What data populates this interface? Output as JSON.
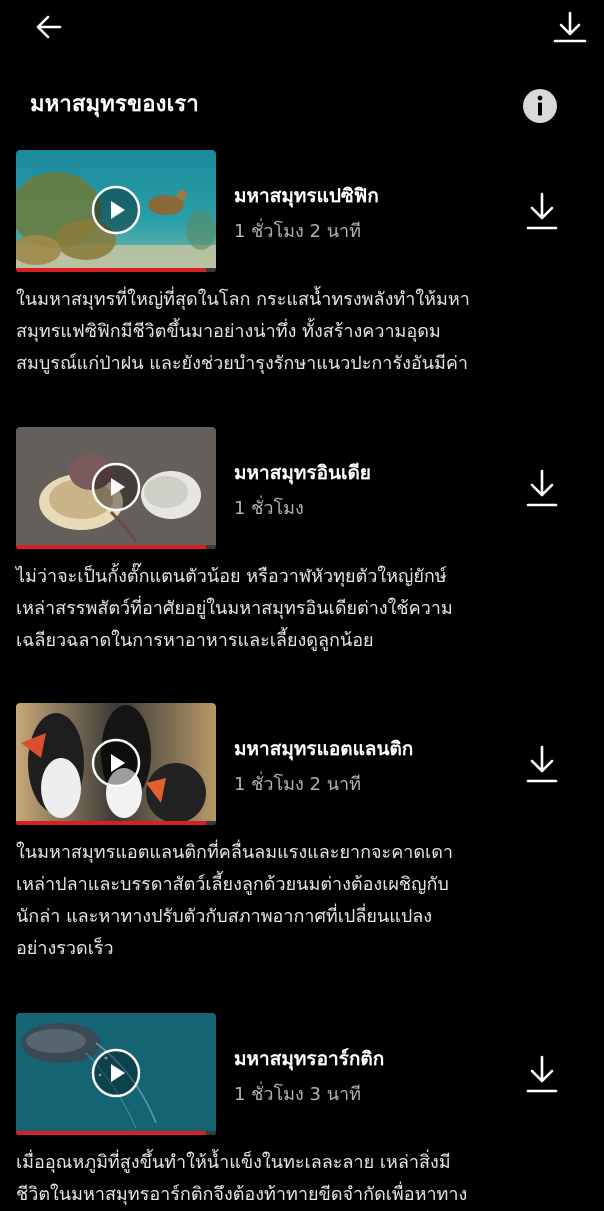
{
  "header": {
    "title": "มหาสมุทรของเรา"
  },
  "icons": {
    "back": "arrow-left-icon",
    "download": "download-icon",
    "info": "info-icon",
    "play": "play-icon"
  },
  "colors": {
    "background": "#000000",
    "progress": "#d81f26",
    "muted_text": "#b3b3b3"
  },
  "episodes": [
    {
      "title": "มหาสมุทรแปซิฟิก",
      "duration": "1 ชั่วโมง 2 นาที",
      "progress": 0.95,
      "description_lines": [
        "ในมหาสมุทรที่ใหญ่ที่สุดในโลก กระแสน้ำทรงพลังทำให้มหา",
        "สมุทรแฟซิฟิกมีชีวิตขึ้นมาอย่างน่าทึ่ง ทั้งสร้างความอุดม",
        "สมบูรณ์แก่ป่าฝน และยังช่วยบำรุงรักษาแนวปะการังอันมีค่า"
      ]
    },
    {
      "title": "มหาสมุทรอินเดีย",
      "duration": "1 ชั่วโมง",
      "progress": 0.95,
      "description_lines": [
        "ไม่ว่าจะเป็นกั้งตั๊กแตนตัวน้อย หรือวาฬหัวทุยตัวใหญ่ยักษ์",
        "เหล่าสรรพสัตว์ที่อาศัยอยู่ในมหาสมุทรอินเดียต่างใช้ความ",
        "เฉลียวฉลาดในการหาอาหารและเลี้ยงดูลูกน้อย"
      ]
    },
    {
      "title": "มหาสมุทรแอตแลนติก",
      "duration": "1 ชั่วโมง 2 นาที",
      "progress": 0.95,
      "description_lines": [
        "ในมหาสมุทรแอตแลนติกที่คลื่นลมแรงและยากจะคาดเดา",
        "เหล่าปลาและบรรดาสัตว์เลี้ยงลูกด้วยนมต่างต้องเผชิญกับ",
        "นักล่า และหาทางปรับตัวกับสภาพอากาศที่เปลี่ยนแปลง",
        "อย่างรวดเร็ว"
      ]
    },
    {
      "title": "มหาสมุทรอาร์กติก",
      "duration": "1 ชั่วโมง 3 นาที",
      "progress": 0.95,
      "description_lines": [
        "เมื่ออุณหภูมิที่สูงขึ้นทำให้น้ำแข็งในทะเลละลาย เหล่าสิ่งมี",
        "ชีวิตในมหาสมุทรอาร์กติกจึงต้องท้าทายขีดจำกัดเพื่อหาทาง"
      ]
    }
  ]
}
